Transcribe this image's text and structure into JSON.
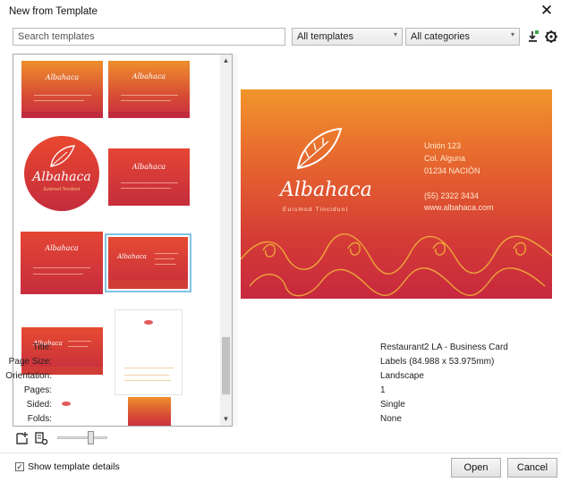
{
  "window": {
    "title": "New from Template"
  },
  "toolbar": {
    "search_placeholder": "Search templates",
    "filter_templates": "All templates",
    "filter_categories": "All categories"
  },
  "thumbnails": {
    "brand": "Albahaca",
    "tagline": "Euismod Tincidunt"
  },
  "preview": {
    "brand": "Albahaca",
    "tagline": "Euismod Tincidunt",
    "address_lines": [
      "Unión 123",
      "Col. Alguna",
      "01234 NACIÓN"
    ],
    "phone": "(55) 2322 3434",
    "website": "www.albahaca.com"
  },
  "details": [
    {
      "label": "Title:",
      "value": "Restaurant2 LA - Business Card"
    },
    {
      "label": "Page Size:",
      "value": "Labels (84.988 x 53.975mm)"
    },
    {
      "label": "Orientation:",
      "value": "Landscape"
    },
    {
      "label": "Pages:",
      "value": "1"
    },
    {
      "label": "Sided:",
      "value": "Single"
    },
    {
      "label": "Folds:",
      "value": "None"
    }
  ],
  "footer": {
    "show_details_label": "Show template details",
    "show_details_checked": true,
    "open_label": "Open",
    "cancel_label": "Cancel"
  },
  "colors": {
    "card_top": "#f1952b",
    "card_bottom": "#c7283e",
    "selection": "#7fc4ea"
  },
  "zoom_slider": {
    "value": 0.6
  }
}
